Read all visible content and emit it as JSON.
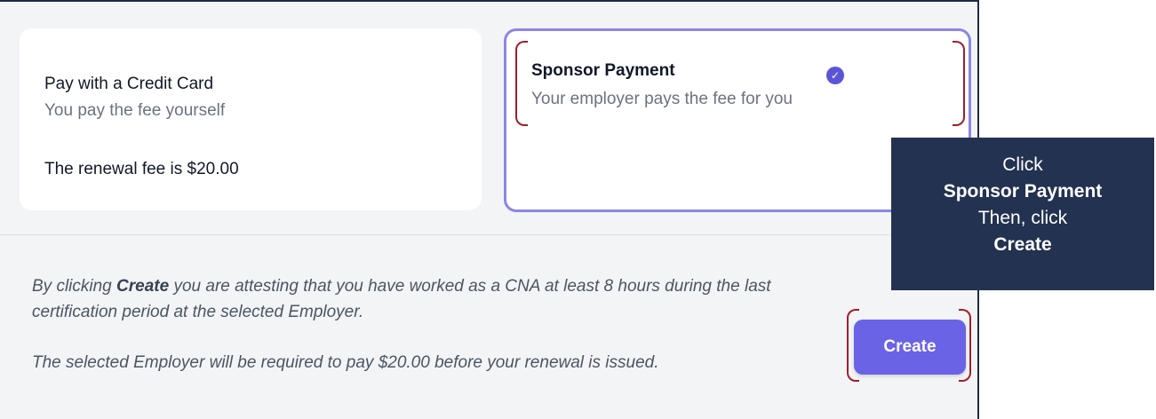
{
  "payment_options": {
    "credit_card": {
      "title": "Pay with a Credit Card",
      "subtitle": "You pay the fee yourself",
      "fee_text": "The renewal fee is $20.00"
    },
    "sponsor": {
      "title": "Sponsor Payment",
      "subtitle": "Your employer pays the fee for you",
      "selected": true,
      "check_icon": "✓"
    }
  },
  "attestation": {
    "line1_prefix": "By clicking ",
    "line1_bold": "Create",
    "line1_suffix": " you are attesting that you have worked as a CNA at least 8 hours during the last certification period at the selected Employer.",
    "line2": "The selected Employer will be required to pay $20.00 before your renewal is issued."
  },
  "actions": {
    "create_label": "Create"
  },
  "callout": {
    "line1": "Click",
    "line2": "Sponsor Payment",
    "line3": "Then, click",
    "line4": "Create"
  },
  "colors": {
    "accent": "#6a63e6",
    "selected_border": "#8b86e6",
    "bracket": "#a01d2a",
    "callout_bg": "#233250"
  }
}
